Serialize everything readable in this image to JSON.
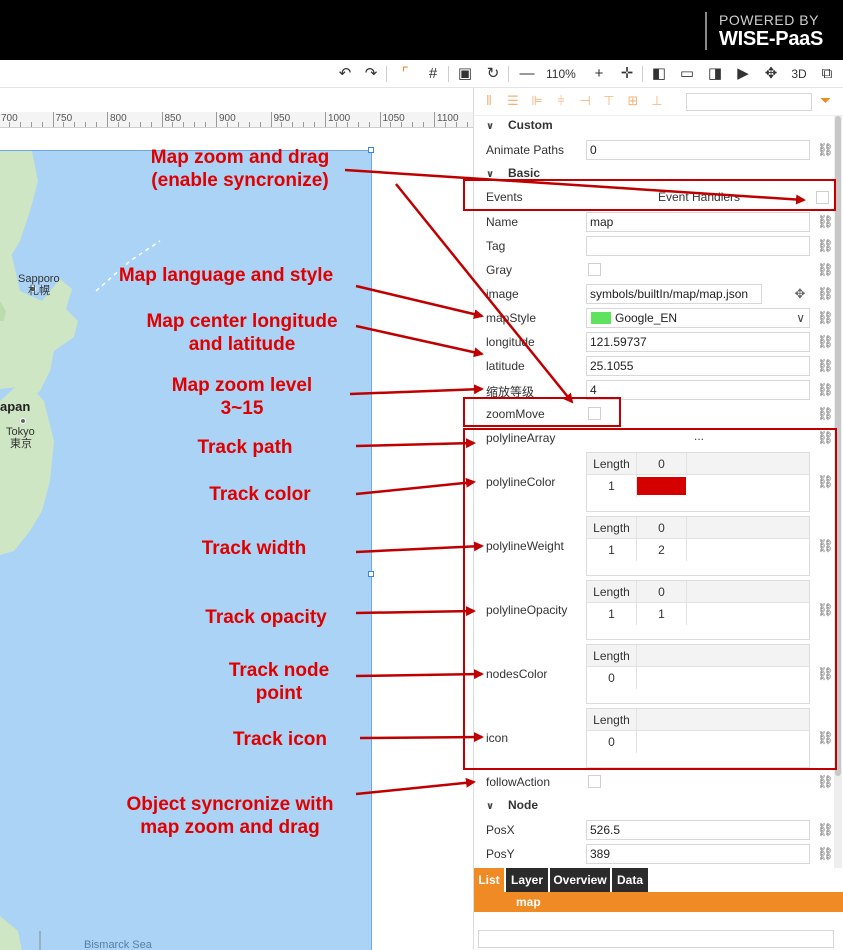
{
  "brand": {
    "line1": "POWERED BY",
    "line2": "WISE-PaaS"
  },
  "toolbar": {
    "zoom": "110%",
    "icons": [
      "undo-icon",
      "redo-icon",
      "select-icon",
      "grid-icon",
      "save-icon",
      "refresh-icon",
      "zoom-out-icon",
      "zoom-in-icon",
      "center-icon",
      "layout-left-icon",
      "layout-full-icon",
      "layout-right-icon",
      "play-icon",
      "move-icon",
      "3d-icon",
      "fullscreen-icon"
    ],
    "three_d": "3D"
  },
  "ruler": {
    "labels": [
      "700",
      "750",
      "800",
      "850",
      "900",
      "950",
      "1000",
      "1050",
      "1100"
    ]
  },
  "map": {
    "labels": [
      {
        "key": "sapporo",
        "text": "Sapporo"
      },
      {
        "key": "sapporo_jp",
        "text": "札幌"
      },
      {
        "key": "japan",
        "text": "apan"
      },
      {
        "key": "tokyo",
        "text": "Tokyo"
      },
      {
        "key": "tokyo_jp",
        "text": "東京"
      },
      {
        "key": "bismarck",
        "text": "Bismarck Sea"
      }
    ]
  },
  "annotations": {
    "zoom_drag": "Map zoom and drag\n(enable syncronize)",
    "lang_style": "Map language and style",
    "center": "Map center longitude\nand latitude",
    "zoom_level": "Map zoom level\n3~15",
    "track_path": "Track path",
    "track_color": "Track color",
    "track_width": "Track width",
    "track_opacity": "Track opacity",
    "track_node": "Track node\npoint",
    "track_icon": "Track icon",
    "sync_object": "Object syncronize with\nmap zoom and drag"
  },
  "panel": {
    "custom": {
      "title": "Custom",
      "animate_label": "Animate Paths",
      "animate_value": "0"
    },
    "basic": {
      "title": "Basic",
      "events_label": "Events",
      "event_handlers": "Event Handlers",
      "name_label": "Name",
      "name_value": "map",
      "tag_label": "Tag",
      "tag_value": "",
      "gray_label": "Gray",
      "image_label": "image",
      "image_value": "symbols/builtIn/map/map.json",
      "mapstyle_label": "mapStyle",
      "mapstyle_value": "Google_EN",
      "longitude_label": "longitude",
      "longitude_value": "121.59737",
      "latitude_label": "latitude",
      "latitude_value": "25.1055",
      "zoom_label": "缩放等级",
      "zoom_value": "4",
      "zoommove_label": "zoomMove",
      "polylinearray_label": "polylineArray",
      "polylinearray_value": "...",
      "polylinecolor_label": "polylineColor",
      "polylineweight_label": "polylineWeight",
      "polylineopacity_label": "polylineOpacity",
      "nodescolor_label": "nodesColor",
      "icon_label": "icon",
      "followaction_label": "followAction",
      "len_header": "Length",
      "idx0": "0",
      "color_len": "1",
      "weight_len": "1",
      "weight_val": "2",
      "opacity_len": "1",
      "opacity_val": "1",
      "nodes_len": "0",
      "icon_len": "0"
    },
    "node": {
      "title": "Node",
      "posx_label": "PosX",
      "posx_value": "526.5",
      "posy_label": "PosY",
      "posy_value": "389"
    },
    "tabs": [
      "List",
      "Layer",
      "Overview",
      "Data"
    ],
    "list_item": "map"
  },
  "colors": {
    "accent": "#f08a24",
    "annotation": "#e00000",
    "polyline": "#d40000",
    "map_water": "#aad3f5"
  }
}
